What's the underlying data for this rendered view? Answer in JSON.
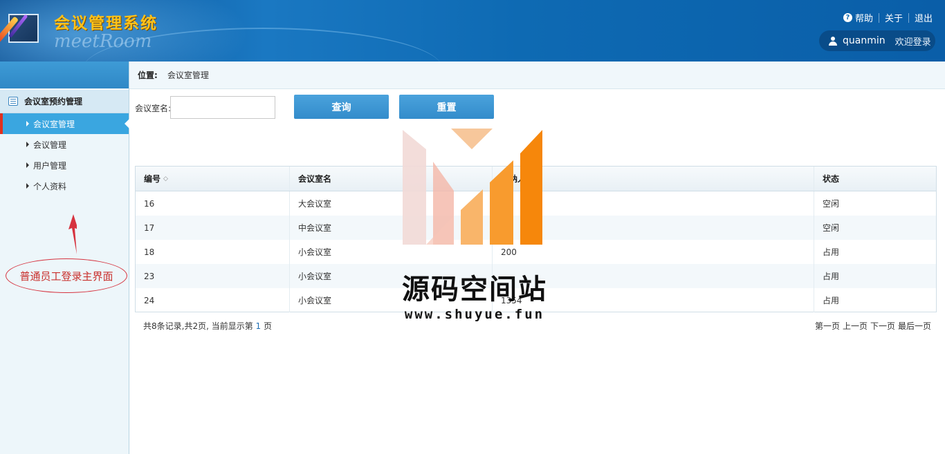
{
  "header": {
    "title": "会议管理系统",
    "subtitle": "meetRoom",
    "links": {
      "help": "帮助",
      "about": "关于",
      "logout": "退出"
    },
    "user": {
      "name": "quanmin",
      "welcome": "欢迎登录"
    }
  },
  "sidebar": {
    "group_label": "会议室预约管理",
    "items": [
      {
        "label": "会议室管理",
        "active": true
      },
      {
        "label": "会议管理"
      },
      {
        "label": "用户管理"
      },
      {
        "label": "个人资料"
      }
    ],
    "annotation": "普通员工登录主界面"
  },
  "breadcrumb": {
    "label": "位置:",
    "value": "会议室管理"
  },
  "search": {
    "label": "会议室名:",
    "value": "",
    "query_button": "查询",
    "reset_button": "重置"
  },
  "table": {
    "columns": [
      "编号",
      "会议室名",
      "容纳人数",
      "状态"
    ],
    "rows": [
      [
        "16",
        "大会议室",
        "50",
        "空闲"
      ],
      [
        "17",
        "中会议室",
        "22",
        "空闲"
      ],
      [
        "18",
        "小会议室",
        "200",
        "占用"
      ],
      [
        "23",
        "小会议室",
        "",
        "占用"
      ],
      [
        "24",
        "小会议室",
        "1354",
        "占用"
      ]
    ]
  },
  "footer": {
    "info_prefix": "共8条记录,共2页, 当前显示第",
    "current_page": "1",
    "info_suffix": "页",
    "pager": {
      "first": "第一页",
      "prev": "上一页",
      "next": "下一页",
      "last": "最后一页"
    }
  },
  "watermark": {
    "text": "源码空间站",
    "url": "www.shuyue.fun"
  },
  "colors": {
    "header": "#0e6ab3",
    "accent": "#3aa6e0",
    "button": "#338ccb",
    "title": "#ffc21a",
    "annotation": "#c9302c"
  }
}
